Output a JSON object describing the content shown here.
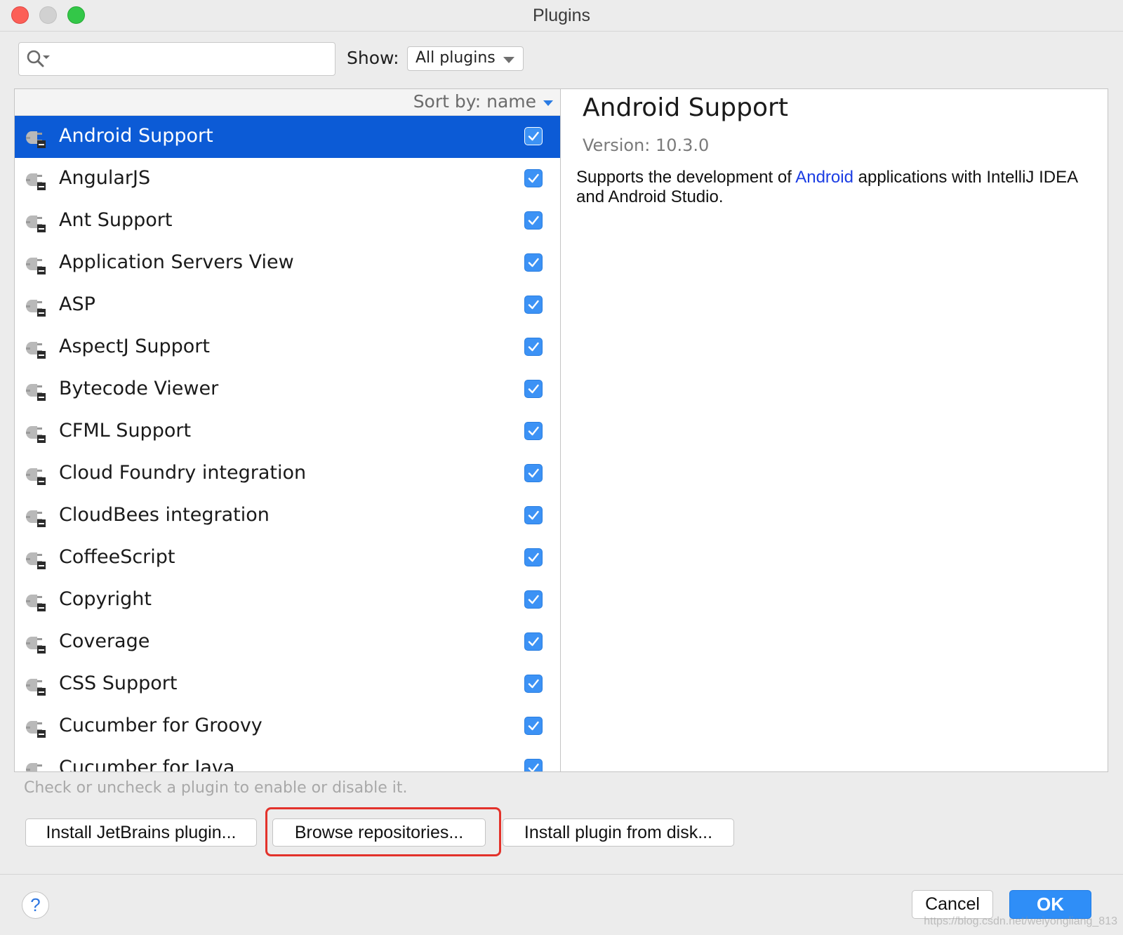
{
  "window": {
    "title": "Plugins"
  },
  "search": {
    "value": "",
    "placeholder": ""
  },
  "filter": {
    "label": "Show:",
    "selected": "All plugins"
  },
  "list": {
    "sort_label": "Sort by: name",
    "plugins": [
      {
        "name": "Android Support",
        "enabled": true,
        "selected": true
      },
      {
        "name": "AngularJS",
        "enabled": true,
        "selected": false
      },
      {
        "name": "Ant Support",
        "enabled": true,
        "selected": false
      },
      {
        "name": "Application Servers View",
        "enabled": true,
        "selected": false
      },
      {
        "name": "ASP",
        "enabled": true,
        "selected": false
      },
      {
        "name": "AspectJ Support",
        "enabled": true,
        "selected": false
      },
      {
        "name": "Bytecode Viewer",
        "enabled": true,
        "selected": false
      },
      {
        "name": "CFML Support",
        "enabled": true,
        "selected": false
      },
      {
        "name": "Cloud Foundry integration",
        "enabled": true,
        "selected": false
      },
      {
        "name": "CloudBees integration",
        "enabled": true,
        "selected": false
      },
      {
        "name": "CoffeeScript",
        "enabled": true,
        "selected": false
      },
      {
        "name": "Copyright",
        "enabled": true,
        "selected": false
      },
      {
        "name": "Coverage",
        "enabled": true,
        "selected": false
      },
      {
        "name": "CSS Support",
        "enabled": true,
        "selected": false
      },
      {
        "name": "Cucumber for Groovy",
        "enabled": true,
        "selected": false
      },
      {
        "name": "Cucumber for Java",
        "enabled": true,
        "selected": false
      }
    ]
  },
  "detail": {
    "title": "Android Support",
    "version": "Version: 10.3.0",
    "desc_before": "Supports the development of ",
    "desc_link": "Android",
    "desc_after": " applications with IntelliJ IDEA and Android Studio."
  },
  "hint": "Check or uncheck a plugin to enable or disable it.",
  "buttons": {
    "install_jetbrains": "Install JetBrains plugin...",
    "browse": "Browse repositories...",
    "install_disk": "Install plugin from disk...",
    "help": "?",
    "cancel": "Cancel",
    "ok": "OK"
  },
  "watermark": "https://blog.csdn.net/weiyongliang_813",
  "colors": {
    "selection": "#0c5bd6",
    "checkbox": "#3c92f5",
    "highlight": "#e3322b",
    "ok_button": "#2f8ef7"
  },
  "icons": {
    "plugin": "plugin-icon",
    "search": "search-icon",
    "checkbox": "checkmark-icon"
  }
}
